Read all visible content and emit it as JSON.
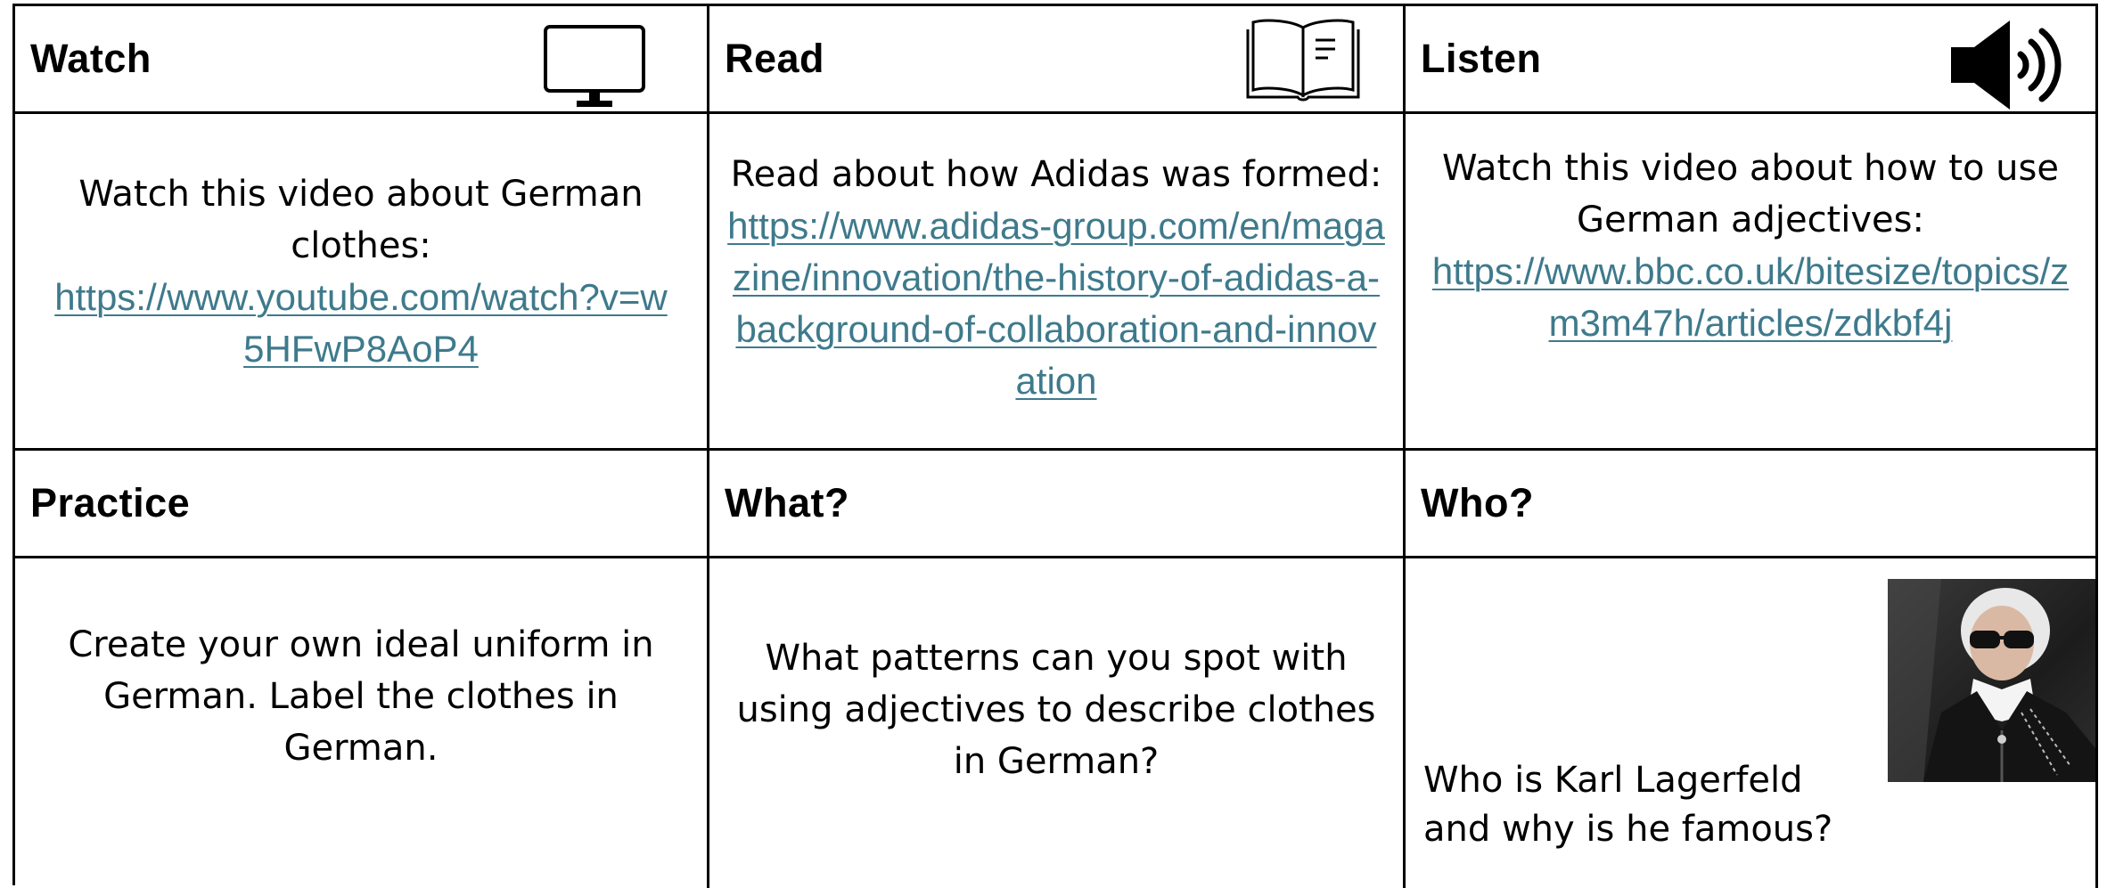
{
  "cells": {
    "watch": {
      "title": "Watch",
      "icon": "monitor-icon",
      "text": "Watch this video about German clothes:",
      "link": "https://www.youtube.com/watch?v=w5HFwP8AoP4"
    },
    "read": {
      "title": "Read",
      "icon": "book-icon",
      "text": "Read about how Adidas was formed:",
      "link": "https://www.adidas-group.com/en/magazine/innovation/the-history-of-adidas-a-background-of-collaboration-and-innovation"
    },
    "listen": {
      "title": "Listen",
      "icon": "speaker-icon",
      "text": "Watch this video about how to use German adjectives:",
      "link": "https://www.bbc.co.uk/bitesize/topics/zm3m47h/articles/zdkbf4j"
    },
    "practice": {
      "title": "Practice",
      "text": "Create your own ideal uniform in German. Label the clothes in German."
    },
    "what": {
      "title": "What?",
      "text": "What patterns can you spot with using adjectives to describe clothes in German?"
    },
    "who": {
      "title": "Who?",
      "text": "Who is Karl Lagerfeld and why is he famous?",
      "image": "portrait-photo"
    }
  },
  "colors": {
    "link": "#3e7a8c",
    "border": "#000000"
  }
}
